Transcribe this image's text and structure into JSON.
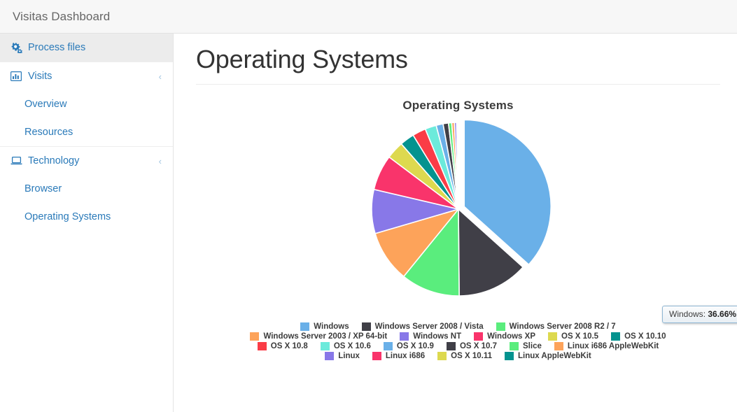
{
  "topbar": {
    "title": "Visitas Dashboard"
  },
  "sidebar": {
    "groups": [
      {
        "item": {
          "label": "Process files",
          "icon": "gears-icon",
          "active": true,
          "chevron": ""
        },
        "children": []
      },
      {
        "item": {
          "label": "Visits",
          "icon": "bar-chart-icon",
          "active": false,
          "chevron": "‹"
        },
        "children": [
          {
            "label": "Overview"
          },
          {
            "label": "Resources"
          }
        ]
      },
      {
        "item": {
          "label": "Technology",
          "icon": "laptop-icon",
          "active": false,
          "chevron": "‹"
        },
        "children": [
          {
            "label": "Browser"
          },
          {
            "label": "Operating Systems"
          }
        ]
      }
    ]
  },
  "main": {
    "page_title": "Operating Systems",
    "tooltip": {
      "label": "Windows",
      "separator": ": ",
      "value": "36.66%"
    }
  },
  "chart_data": {
    "type": "pie",
    "title": "Operating Systems",
    "legend_position": "bottom",
    "exploded_slice": "Windows",
    "labels": [
      "Windows",
      "Windows Server 2008 / Vista",
      "Windows Server 2008 R2 / 7",
      "Windows Server 2003 / XP 64-bit",
      "Windows NT",
      "Windows XP",
      "OS X 10.5",
      "OS X 10.10",
      "OS X 10.8",
      "OS X 10.6",
      "OS X 10.9",
      "OS X 10.7",
      "Slice",
      "Linux i686 AppleWebKit",
      "Linux",
      "Linux i686",
      "OS X 10.11",
      "Linux AppleWebKit"
    ],
    "values": [
      36.66,
      13.2,
      11.0,
      9.6,
      8.2,
      6.6,
      3.3,
      2.7,
      2.5,
      2.1,
      1.3,
      1.0,
      0.6,
      0.5,
      0.4,
      0.2,
      0.1,
      0.04
    ],
    "unit": "%",
    "colors": [
      "#6ab0e8",
      "#403f47",
      "#5aed7d",
      "#fda35a",
      "#8878e8",
      "#f9346b",
      "#ddd94f",
      "#03938f",
      "#fa3c46",
      "#6ceadb",
      "#6ab0e8",
      "#403f47",
      "#5aed7d",
      "#fda35a",
      "#8878e8",
      "#f9346b",
      "#ddd94f",
      "#03938f"
    ],
    "legend_rows": [
      [
        {
          "label": "Windows",
          "color": "#6ab0e8"
        },
        {
          "label": "Windows Server 2008 / Vista",
          "color": "#403f47"
        },
        {
          "label": "Windows Server 2008 R2 / 7",
          "color": "#5aed7d"
        }
      ],
      [
        {
          "label": "Windows Server 2003 / XP 64-bit",
          "color": "#fda35a"
        },
        {
          "label": "Windows NT",
          "color": "#8878e8"
        },
        {
          "label": "Windows XP",
          "color": "#f9346b"
        },
        {
          "label": "OS X 10.5",
          "color": "#ddd94f"
        },
        {
          "label": "OS X 10.10",
          "color": "#03938f"
        }
      ],
      [
        {
          "label": "OS X 10.8",
          "color": "#fa3c46"
        },
        {
          "label": "OS X 10.6",
          "color": "#6ceadb"
        },
        {
          "label": "OS X 10.9",
          "color": "#6ab0e8"
        },
        {
          "label": "OS X 10.7",
          "color": "#403f47"
        },
        {
          "label": "Slice",
          "color": "#5aed7d"
        },
        {
          "label": "Linux i686 AppleWebKit",
          "color": "#fda35a"
        }
      ],
      [
        {
          "label": "Linux",
          "color": "#8878e8"
        },
        {
          "label": "Linux i686",
          "color": "#f9346b"
        },
        {
          "label": "OS X 10.11",
          "color": "#ddd94f"
        },
        {
          "label": "Linux AppleWebKit",
          "color": "#03938f"
        }
      ]
    ]
  }
}
